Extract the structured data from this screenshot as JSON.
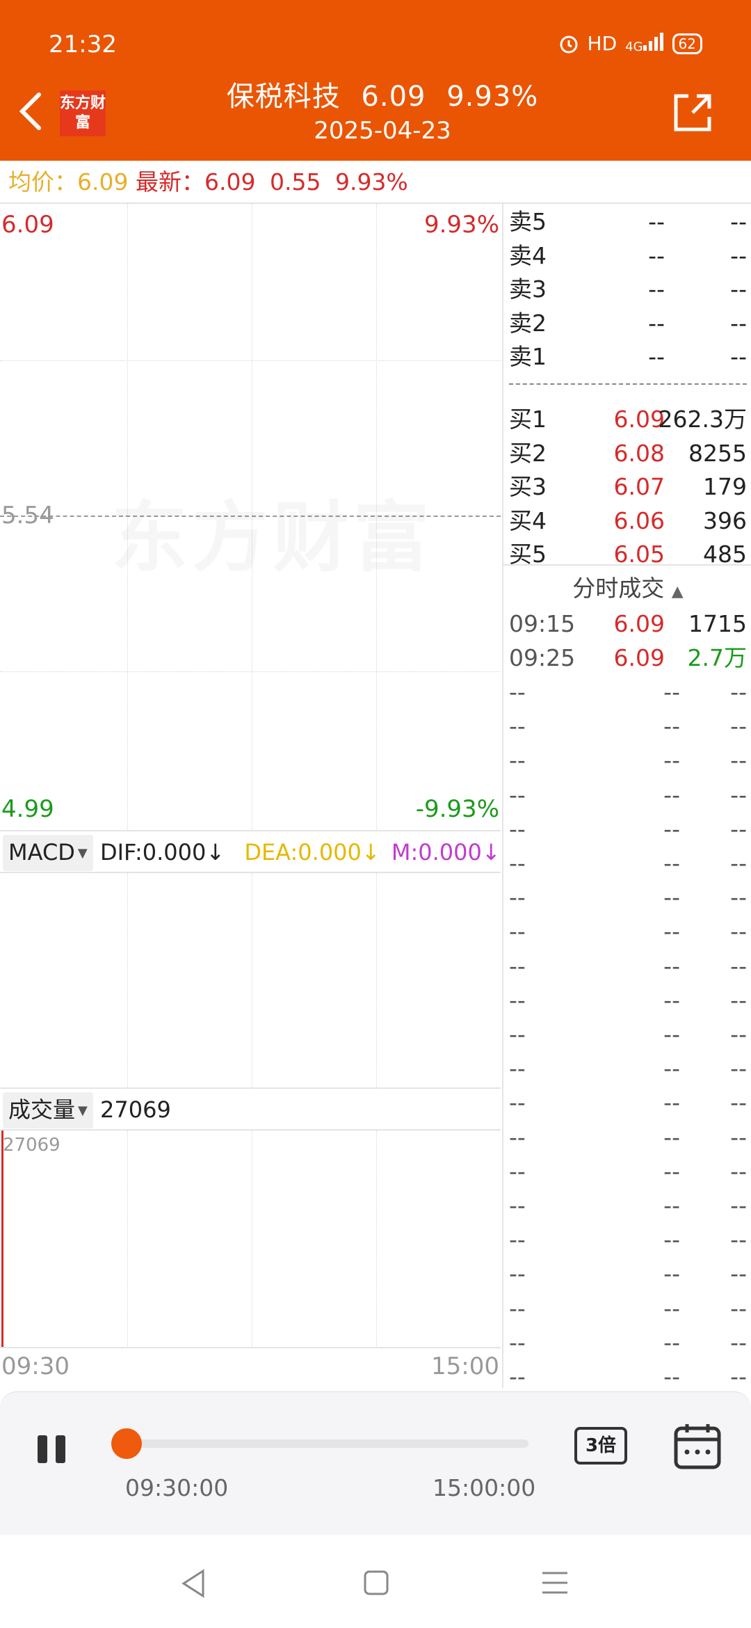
{
  "status": {
    "time": "21:32",
    "hd": "HD",
    "signal": "4G",
    "battery": "62"
  },
  "header": {
    "logo": "东方财富",
    "stock_name": "保税科技",
    "price": "6.09",
    "pct": "9.93%",
    "date": "2025-04-23"
  },
  "quote": {
    "avg_label": "均价：",
    "avg_value": "6.09",
    "latest_label": "最新：",
    "latest_price": "6.09",
    "change": "0.55",
    "pct": "9.93%"
  },
  "chart": {
    "top_price": "6.09",
    "top_pct": "9.93%",
    "mid_price": "5.54",
    "bottom_price": "4.99",
    "bottom_pct": "-9.93%",
    "watermark": "东方财富"
  },
  "macd": {
    "name": "MACD",
    "dif": "DIF:0.000↓",
    "dea": "DEA:0.000↓",
    "m": "M:0.000↓"
  },
  "volume": {
    "name": "成交量",
    "value": "27069",
    "axis_max": "27069",
    "start_time": "09:30",
    "end_time": "15:00"
  },
  "order_book": {
    "sell": [
      {
        "label": "卖5",
        "price": "--",
        "vol": "--"
      },
      {
        "label": "卖4",
        "price": "--",
        "vol": "--"
      },
      {
        "label": "卖3",
        "price": "--",
        "vol": "--"
      },
      {
        "label": "卖2",
        "price": "--",
        "vol": "--"
      },
      {
        "label": "卖1",
        "price": "--",
        "vol": "--"
      }
    ],
    "buy": [
      {
        "label": "买1",
        "price": "6.09",
        "vol": "262.3万"
      },
      {
        "label": "买2",
        "price": "6.08",
        "vol": "8255"
      },
      {
        "label": "买3",
        "price": "6.07",
        "vol": "179"
      },
      {
        "label": "买4",
        "price": "6.06",
        "vol": "396"
      },
      {
        "label": "买5",
        "price": "6.05",
        "vol": "485"
      }
    ]
  },
  "trades": {
    "title": "分时成交",
    "rows": [
      {
        "time": "09:15",
        "price": "6.09",
        "vol": "1715"
      },
      {
        "time": "09:25",
        "price": "6.09",
        "vol": "2.7万"
      }
    ],
    "empty": "--"
  },
  "player": {
    "start": "09:30:00",
    "end": "15:00:00",
    "speed": "3倍",
    "progress": 0
  },
  "colors": {
    "brand": "#ea5504",
    "up": "#d52b2b",
    "down": "#1c9a1c",
    "avg": "#e6b02a",
    "dea": "#e6b800",
    "m": "#c23ad1"
  }
}
